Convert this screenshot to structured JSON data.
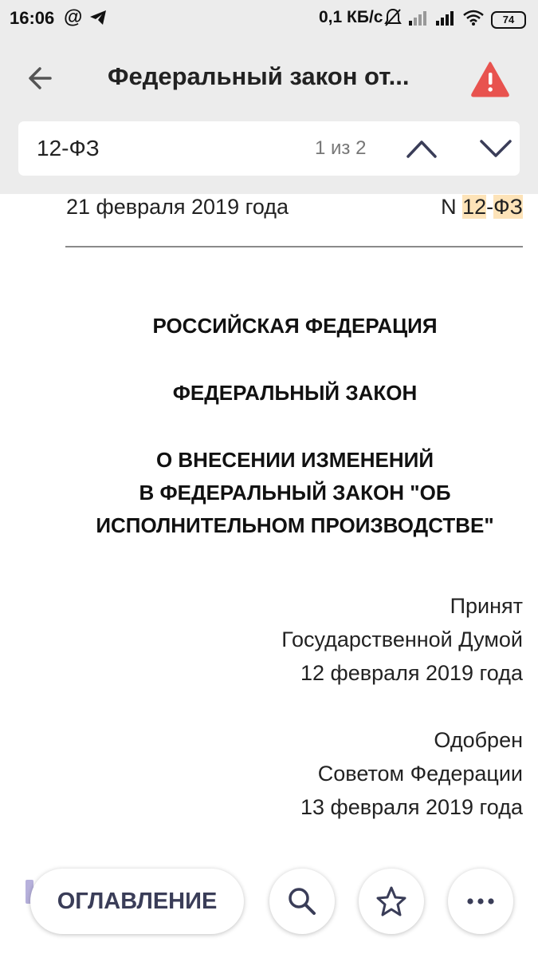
{
  "status_bar": {
    "time": "16:06",
    "at_symbol": "@",
    "speed": "0,1 КБ/с",
    "battery": "74"
  },
  "app_bar": {
    "title": "Федеральный закон от...",
    "icons": {
      "back": "arrow-left-icon",
      "warning": "warning-icon"
    },
    "warning_color": "#e8534f"
  },
  "search": {
    "value": "12-ФЗ",
    "count": "1 из 2",
    "icons": {
      "up": "chevron-up-icon",
      "down": "chevron-down-icon"
    }
  },
  "document": {
    "date": "21 февраля 2019 года",
    "number_prefix": "N",
    "number_part1": "12",
    "number_dash": "-",
    "number_part2": "ФЗ",
    "highlight_color": "#fde3b8",
    "heading_country": "РОССИЙСКАЯ ФЕДЕРАЦИЯ",
    "heading_type": "ФЕДЕРАЛЬНЫЙ ЗАКОН",
    "heading_title_lines": [
      "О ВНЕСЕНИИ ИЗМЕНЕНИЙ",
      "В ФЕДЕРАЛЬНЫЙ ЗАКОН \"ОБ",
      "ИСПОЛНИТЕЛЬНОМ ПРОИЗВОДСТВЕ\""
    ],
    "adopted_lines": [
      "Принят",
      "Государственной Думой",
      "12 февраля 2019 года"
    ],
    "approved_lines": [
      "Одобрен",
      "Советом Федерации",
      "13 февраля 2019 года"
    ]
  },
  "bottom_bar": {
    "toc_label": "ОГЛАВЛЕНИЕ",
    "icons": {
      "search": "search-icon",
      "favorite": "star-icon",
      "more": "more-icon"
    },
    "accent_color": "#3a3d58"
  }
}
